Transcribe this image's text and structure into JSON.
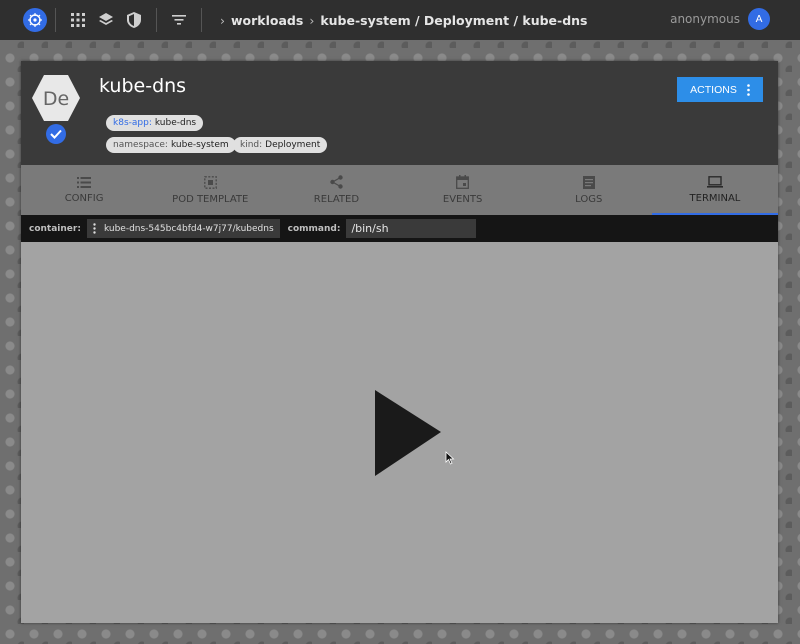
{
  "topbar": {
    "breadcrumbs": [
      "workloads",
      "kube-system / Deployment / kube-dns"
    ],
    "user": "anonymous",
    "avatar_letter": "A"
  },
  "resource": {
    "title": "kube-dns",
    "badge_letters": "De",
    "labels": [
      {
        "key": "k8s-app:",
        "value": "kube-dns"
      },
      {
        "key": "namespace:",
        "value": "kube-system"
      },
      {
        "key": "kind:",
        "value": "Deployment"
      }
    ],
    "actions_label": "ACTIONS"
  },
  "tabs": [
    {
      "label": "CONFIG",
      "icon": "list-icon"
    },
    {
      "label": "POD TEMPLATE",
      "icon": "template-icon"
    },
    {
      "label": "RELATED",
      "icon": "share-icon"
    },
    {
      "label": "EVENTS",
      "icon": "calendar-icon"
    },
    {
      "label": "LOGS",
      "icon": "document-icon"
    },
    {
      "label": "TERMINAL",
      "icon": "laptop-icon",
      "active": true
    }
  ],
  "terminal": {
    "container_label": "container:",
    "container_value": "kube-dns-545bc4bfd4-w7j77/kubedns",
    "command_label": "command:",
    "command_value": "/bin/sh"
  },
  "colors": {
    "accent": "#326ce5",
    "actions_button": "#2d8ee8",
    "header_bg": "#3a3a3a"
  }
}
